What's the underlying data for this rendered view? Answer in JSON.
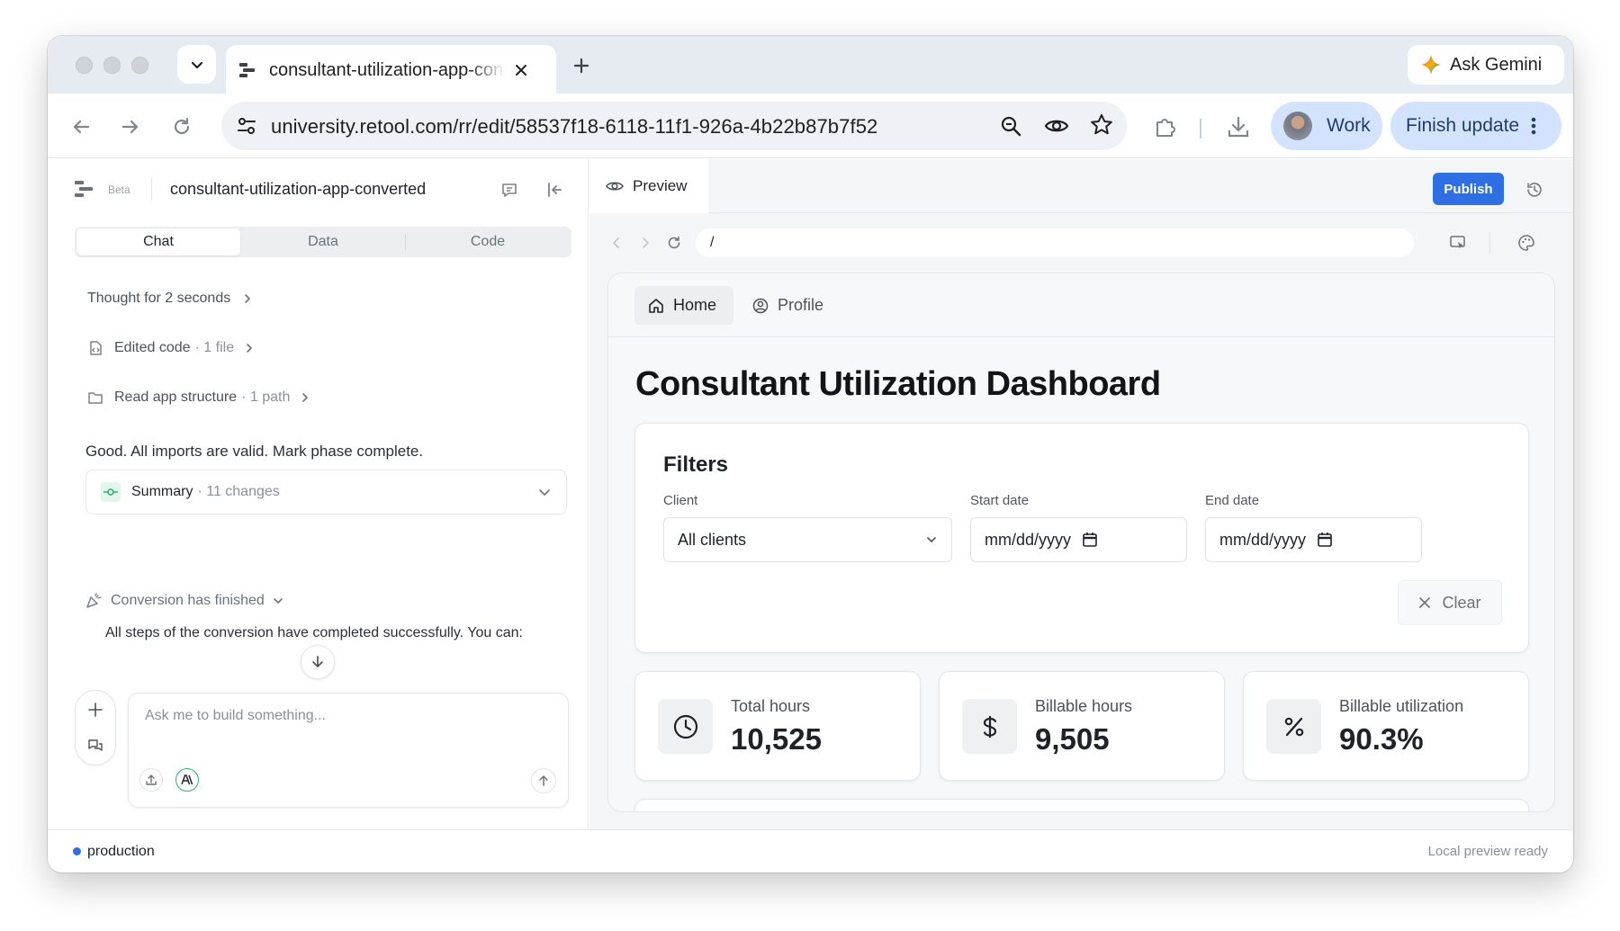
{
  "browser": {
    "tab_title": "consultant-utilization-app-converted",
    "gemini_label": "Ask Gemini",
    "url": "university.retool.com/rr/edit/58537f18-6118-11f1-926a-4b22b87b7f52",
    "profile_label": "Work",
    "update_label": "Finish update"
  },
  "editor": {
    "beta_label": "Beta",
    "app_name": "consultant-utilization-app-converted",
    "tabs": [
      "Chat",
      "Data",
      "Code"
    ],
    "active_tab": "Chat",
    "chat": {
      "thought": "Thought for 2 seconds",
      "edited_code": "Edited code",
      "edited_code_meta": "· 1 file",
      "read_structure": "Read app structure",
      "read_structure_meta": "· 1 path",
      "message": "Good. All imports are valid. Mark phase complete.",
      "summary_label": "Summary",
      "summary_meta": "· 11 changes",
      "conversion_title": "Conversion has finished",
      "conversion_text": "All steps of the conversion have completed successfully. You can:",
      "input_placeholder": "Ask me to build something..."
    },
    "preview_label": "Preview",
    "publish_label": "Publish",
    "path": "/"
  },
  "app": {
    "nav": [
      "Home",
      "Profile"
    ],
    "title": "Consultant Utilization Dashboard",
    "filters": {
      "heading": "Filters",
      "client_label": "Client",
      "client_value": "All clients",
      "start_label": "Start date",
      "start_placeholder": "mm/dd/yyyy",
      "end_label": "End date",
      "end_placeholder": "mm/dd/yyyy",
      "clear_label": "Clear"
    },
    "kpis": [
      {
        "label": "Total hours",
        "value": "10,525",
        "icon": "clock-icon"
      },
      {
        "label": "Billable hours",
        "value": "9,505",
        "icon": "dollar-icon"
      },
      {
        "label": "Billable utilization",
        "value": "90.3%",
        "icon": "percent-icon"
      }
    ]
  },
  "status": {
    "env": "production",
    "preview_status": "Local preview ready"
  },
  "colors": {
    "accent": "#2f6fe4",
    "profile_pill": "#d3e3fd",
    "summary_icon": "#2bb673"
  }
}
